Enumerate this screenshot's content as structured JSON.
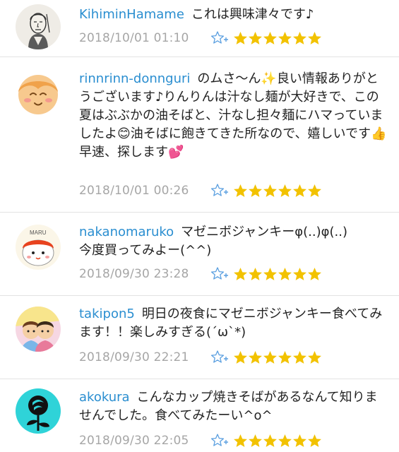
{
  "comments": [
    {
      "username": "KihiminHamame",
      "text": "これは興味津々です♪",
      "timestamp": "2018/10/01 01:10",
      "rating": 6,
      "avatar_icon": "face-portrait-icon"
    },
    {
      "username": "rinnrinn-donnguri",
      "text": "のムさ〜ん✨良い情報ありがとうございます♪りんりんは汁なし麺が大好きで、この夏はぶぶかの油そばと、汁なし担々麺にハマっていましたよ😊油そばに飽きてきた所なので、嬉しいです👍早速、探します💕",
      "timestamp": "2018/10/01 00:26",
      "rating": 6,
      "avatar_icon": "smiling-face-icon"
    },
    {
      "username": "nakanomaruko",
      "text": "マゼニボジャンキーφ(..)φ(..)\n今度買ってみよー(^^)",
      "timestamp": "2018/09/30 23:28",
      "rating": 6,
      "avatar_icon": "maru-character-icon",
      "avatar_label": "MARU"
    },
    {
      "username": "takipon5",
      "text": "明日の夜食にマゼニボジャンキー食べてみます！！楽しみすぎる(´ω`*)",
      "timestamp": "2018/09/30 22:21",
      "rating": 6,
      "avatar_icon": "two-people-icon"
    },
    {
      "username": "akokura",
      "text": "こんなカップ焼きそばがあるなんて知りませんでした。食べてみたーい^o^",
      "timestamp": "2018/09/30 22:05",
      "rating": 6,
      "avatar_icon": "rose-icon"
    }
  ],
  "colors": {
    "username": "#2a8ed0",
    "timestamp": "#a6a6a6",
    "star": "#f2c200",
    "fav_icon": "#5a9fe0",
    "divider": "#e3e3e3"
  },
  "icons": {
    "favorite": "star-plus-icon",
    "rating": "star-icon"
  }
}
